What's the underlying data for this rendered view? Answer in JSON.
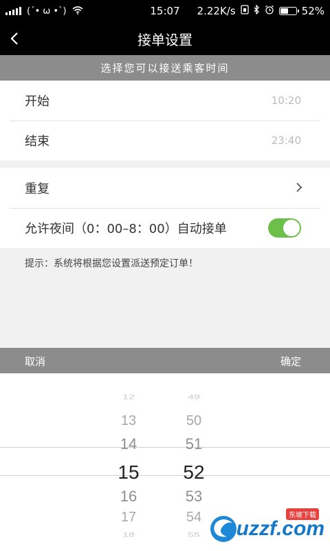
{
  "status_bar": {
    "carrier_face": "(´• ω •`)",
    "time": "15:07",
    "speed": "2.22K/s",
    "battery": "52%",
    "battery_level": 0.52
  },
  "nav": {
    "title": "接单设置",
    "back_icon": "chevron-left-icon"
  },
  "section_header": "选择您可以接送乘客时间",
  "time_rows": [
    {
      "label": "开始",
      "value": "10:20"
    },
    {
      "label": "结束",
      "value": "23:40"
    }
  ],
  "options": {
    "repeat_label": "重复",
    "night_label": "允许夜间（0：00–8：00）自动接单",
    "night_enabled": true
  },
  "hint": "提示：系统将根据您设置派送预定订单！",
  "picker": {
    "cancel": "取消",
    "confirm": "确定",
    "hours": [
      "12",
      "13",
      "14",
      "15",
      "16",
      "17",
      "18"
    ],
    "minutes": [
      "49",
      "50",
      "51",
      "52",
      "53",
      "54",
      "55"
    ],
    "selected_hour": "15",
    "selected_minute": "52"
  },
  "watermark": {
    "text": "uzzf.com",
    "tag": "东坡下载"
  },
  "colors": {
    "toggle_on": "#6cc04a",
    "header_gray": "#8c8c8c"
  }
}
